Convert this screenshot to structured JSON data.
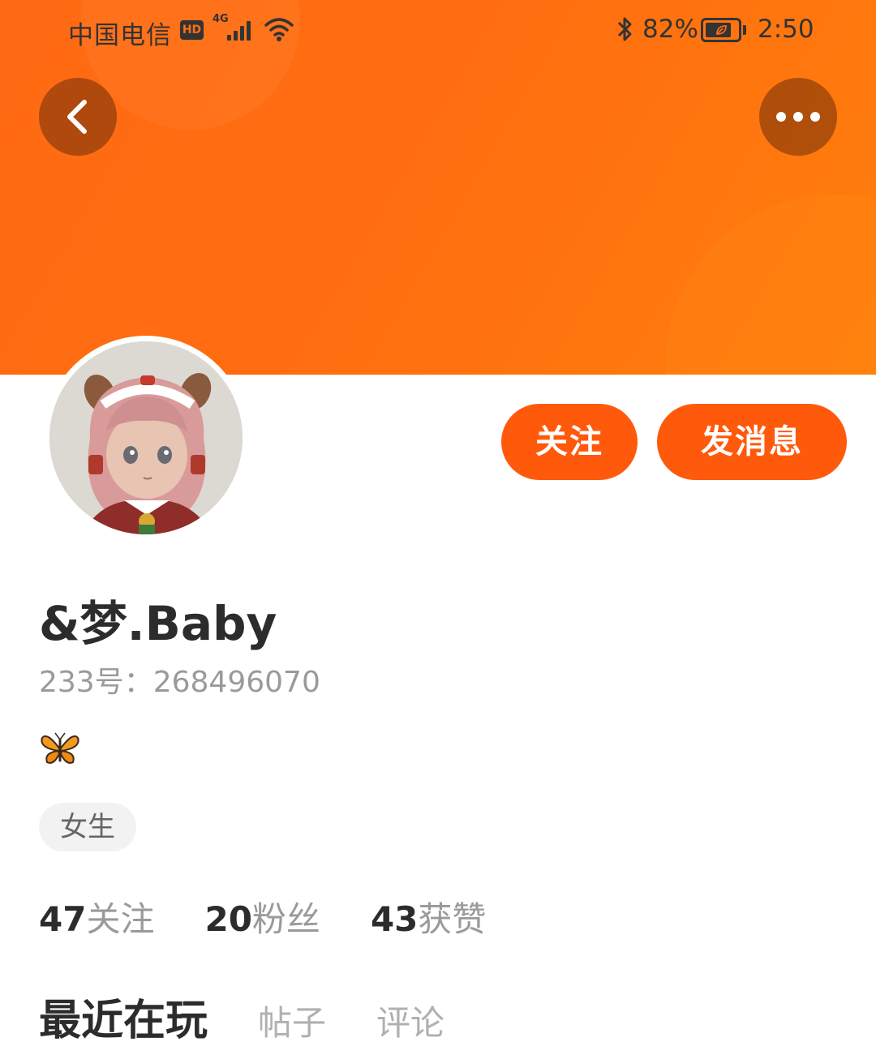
{
  "status_bar": {
    "carrier": "中国电信",
    "hd_badge": "HD",
    "network": "4G",
    "battery_percent": "82%",
    "battery_level": 0.82,
    "time": "2:50"
  },
  "header": {
    "back_icon": "chevron-left-icon",
    "more_icon": "more-horizontal-icon",
    "banner_color": "#ff6d10"
  },
  "profile": {
    "nickname": "&梦.Baby",
    "uid": "233号：268496070",
    "bio_icon": "butterfly-icon",
    "gender_tag": "女生"
  },
  "actions": {
    "follow_label": "关注",
    "message_label": "发消息",
    "accent_color": "#ff5a0c"
  },
  "stats": [
    {
      "value": "47",
      "label": "关注"
    },
    {
      "value": "20",
      "label": "粉丝"
    },
    {
      "value": "43",
      "label": "获赞"
    }
  ],
  "tabs": [
    {
      "label": "最近在玩",
      "active": true
    },
    {
      "label": "帖子",
      "active": false
    },
    {
      "label": "评论",
      "active": false
    }
  ]
}
